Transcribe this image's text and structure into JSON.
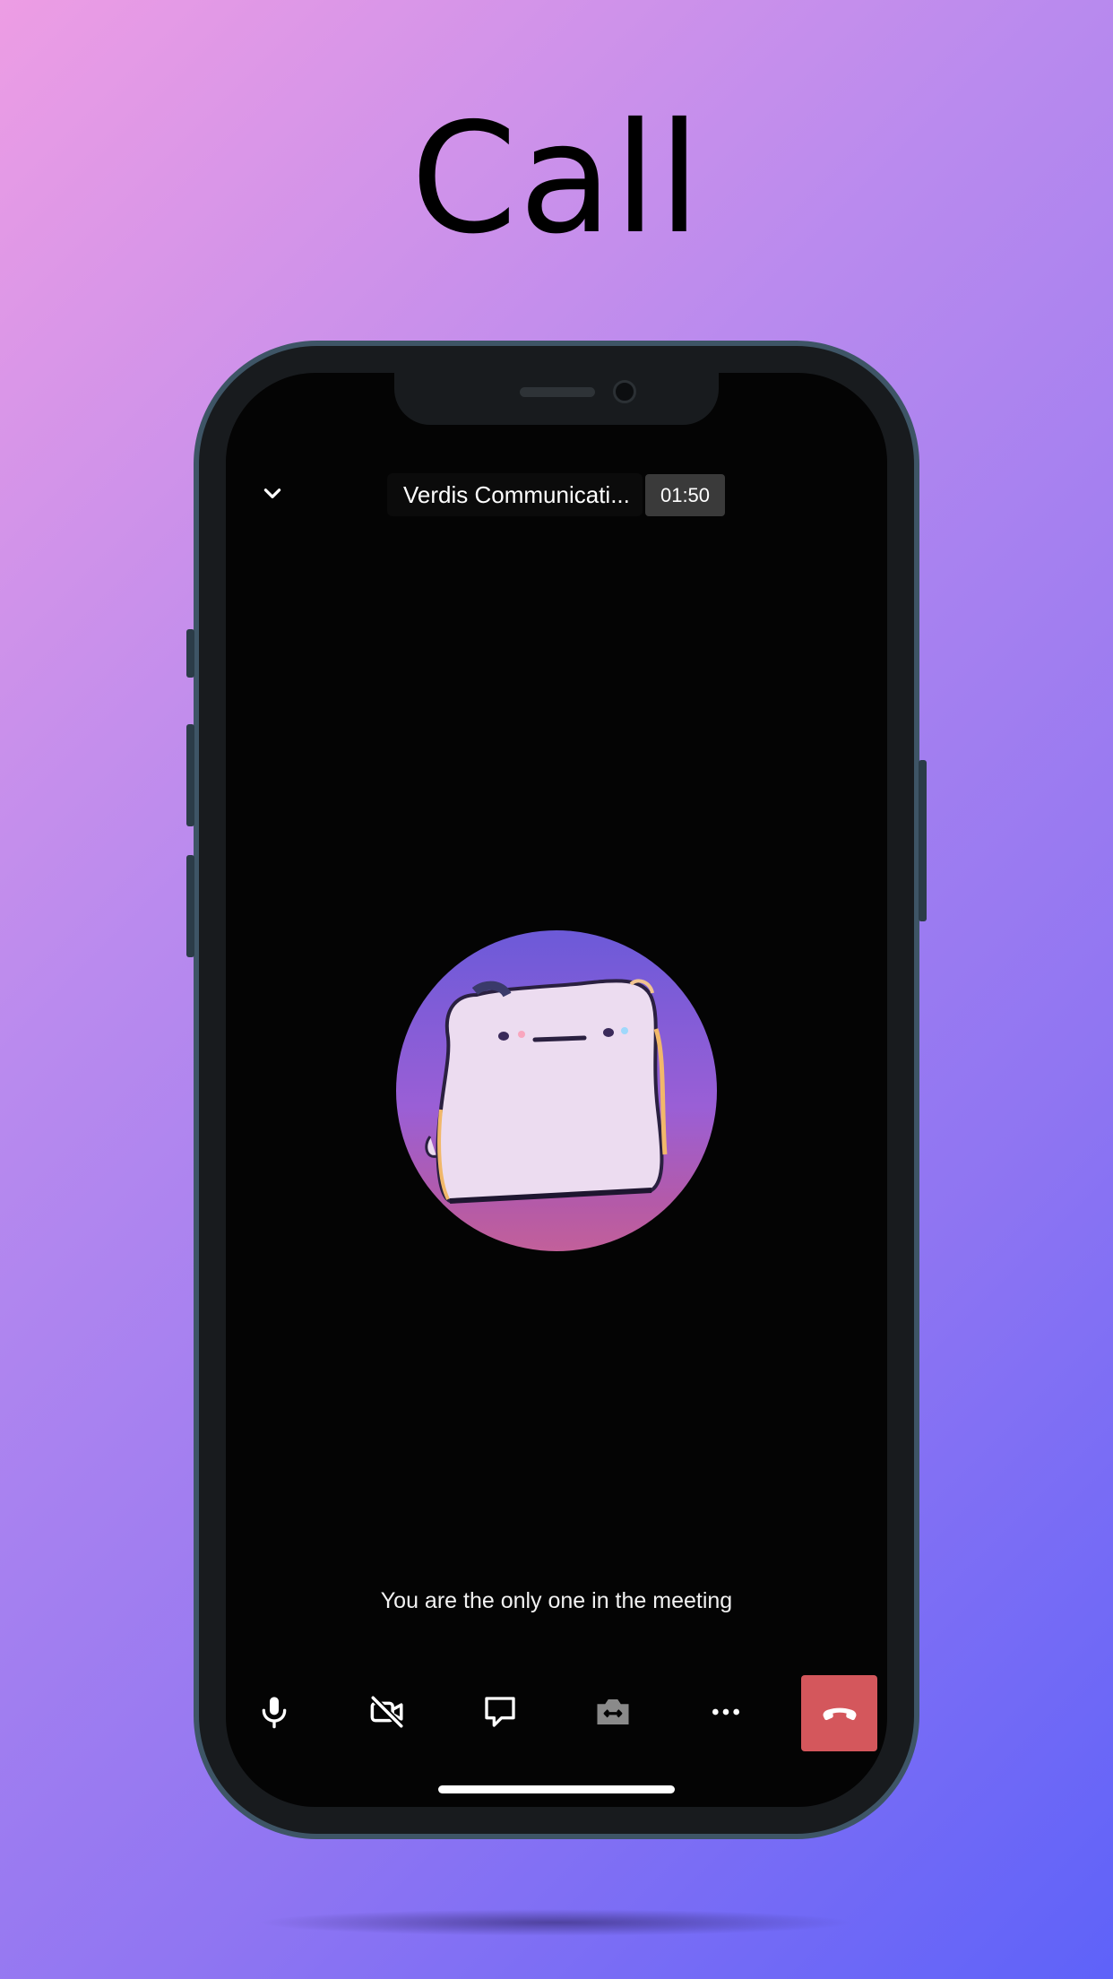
{
  "page": {
    "title": "Call"
  },
  "call": {
    "meeting_name": "Verdis Communicati...",
    "elapsed": "01:50",
    "status_message": "You are the only one in the meeting"
  },
  "icons": {
    "collapse": "chevron-down-icon",
    "microphone": "microphone-icon",
    "camera_off": "video-off-icon",
    "chat": "chat-bubble-icon",
    "switch_camera": "switch-camera-icon",
    "more": "more-horizontal-icon",
    "end_call": "phone-hangup-icon"
  },
  "colors": {
    "end_call_red": "#d4575c",
    "timer_bg": "#3a3a3a",
    "disabled_icon": "#8a8a8a"
  }
}
